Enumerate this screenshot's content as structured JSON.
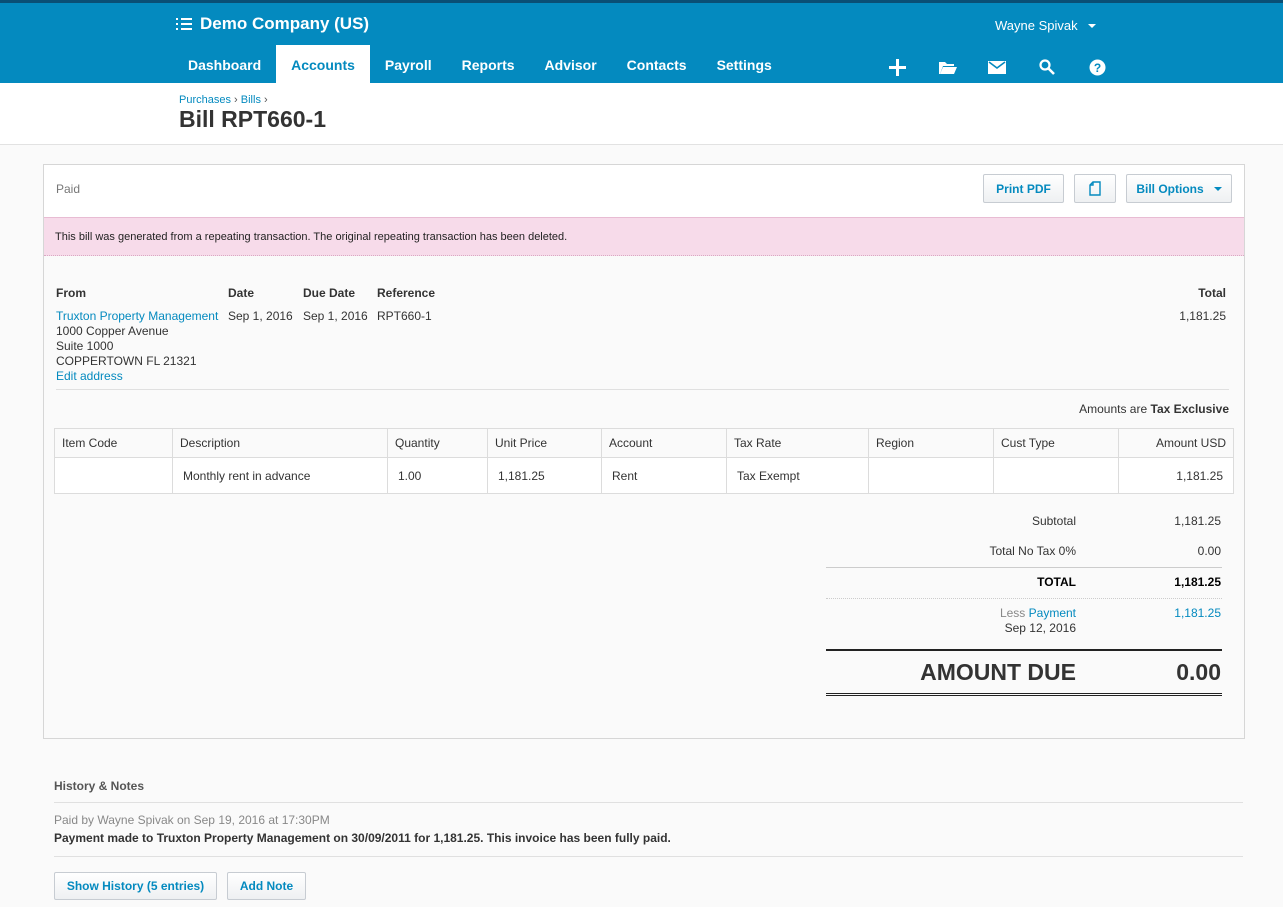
{
  "topbar": {
    "org_name": "Demo Company (US)",
    "user_name": "Wayne Spivak",
    "nav": [
      {
        "label": "Dashboard"
      },
      {
        "label": "Accounts"
      },
      {
        "label": "Payroll"
      },
      {
        "label": "Reports"
      },
      {
        "label": "Advisor"
      },
      {
        "label": "Contacts"
      },
      {
        "label": "Settings"
      }
    ],
    "active_nav": "Accounts",
    "icons": [
      "add-icon",
      "folder-icon",
      "mail-icon",
      "search-icon",
      "help-icon"
    ]
  },
  "breadcrumb": {
    "purchases": "Purchases",
    "bills": "Bills",
    "sep": "›"
  },
  "page_title": "Bill RPT660-1",
  "bill": {
    "status": "Paid",
    "print_pdf": "Print PDF",
    "bill_options": "Bill Options",
    "notice": "This bill was generated from a repeating transaction. The original repeating transaction has been deleted.",
    "from_label": "From",
    "date_label": "Date",
    "due_date_label": "Due Date",
    "reference_label": "Reference",
    "total_label": "Total",
    "supplier": "Truxton Property Management",
    "address_line1": "1000 Copper Avenue",
    "address_line2": "Suite 1000",
    "address_line3": "COPPERTOWN FL 21321",
    "edit_address": "Edit address",
    "date": "Sep 1, 2016",
    "due_date": "Sep 1, 2016",
    "reference": "RPT660-1",
    "total": "1,181.25",
    "amounts_are_label": "Amounts are",
    "amounts_are_value": "Tax Exclusive"
  },
  "line_items": {
    "columns": [
      "Item Code",
      "Description",
      "Quantity",
      "Unit Price",
      "Account",
      "Tax Rate",
      "Region",
      "Cust Type",
      "Amount USD"
    ],
    "rows": [
      {
        "item_code": "",
        "description": "Monthly rent in advance",
        "quantity": "1.00",
        "unit_price": "1,181.25",
        "account": "Rent",
        "tax_rate": "Tax Exempt",
        "region": "",
        "cust_type": "",
        "amount": "1,181.25"
      }
    ]
  },
  "totals": {
    "subtotal_label": "Subtotal",
    "subtotal": "1,181.25",
    "tax_label": "Total No Tax 0%",
    "tax": "0.00",
    "total_label": "TOTAL",
    "total": "1,181.25",
    "less_label": "Less",
    "payment_label": "Payment",
    "payment_date": "Sep 12, 2016",
    "payment_amount": "1,181.25",
    "amount_due_label": "AMOUNT DUE",
    "amount_due": "0.00"
  },
  "history": {
    "title": "History & Notes",
    "meta": "Paid by Wayne Spivak on Sep 19, 2016 at 17:30PM",
    "text": "Payment made to Truxton Property Management on 30/09/2011 for 1,181.25. This invoice has been fully paid.",
    "show_history": "Show History (5 entries)",
    "add_note": "Add Note"
  }
}
